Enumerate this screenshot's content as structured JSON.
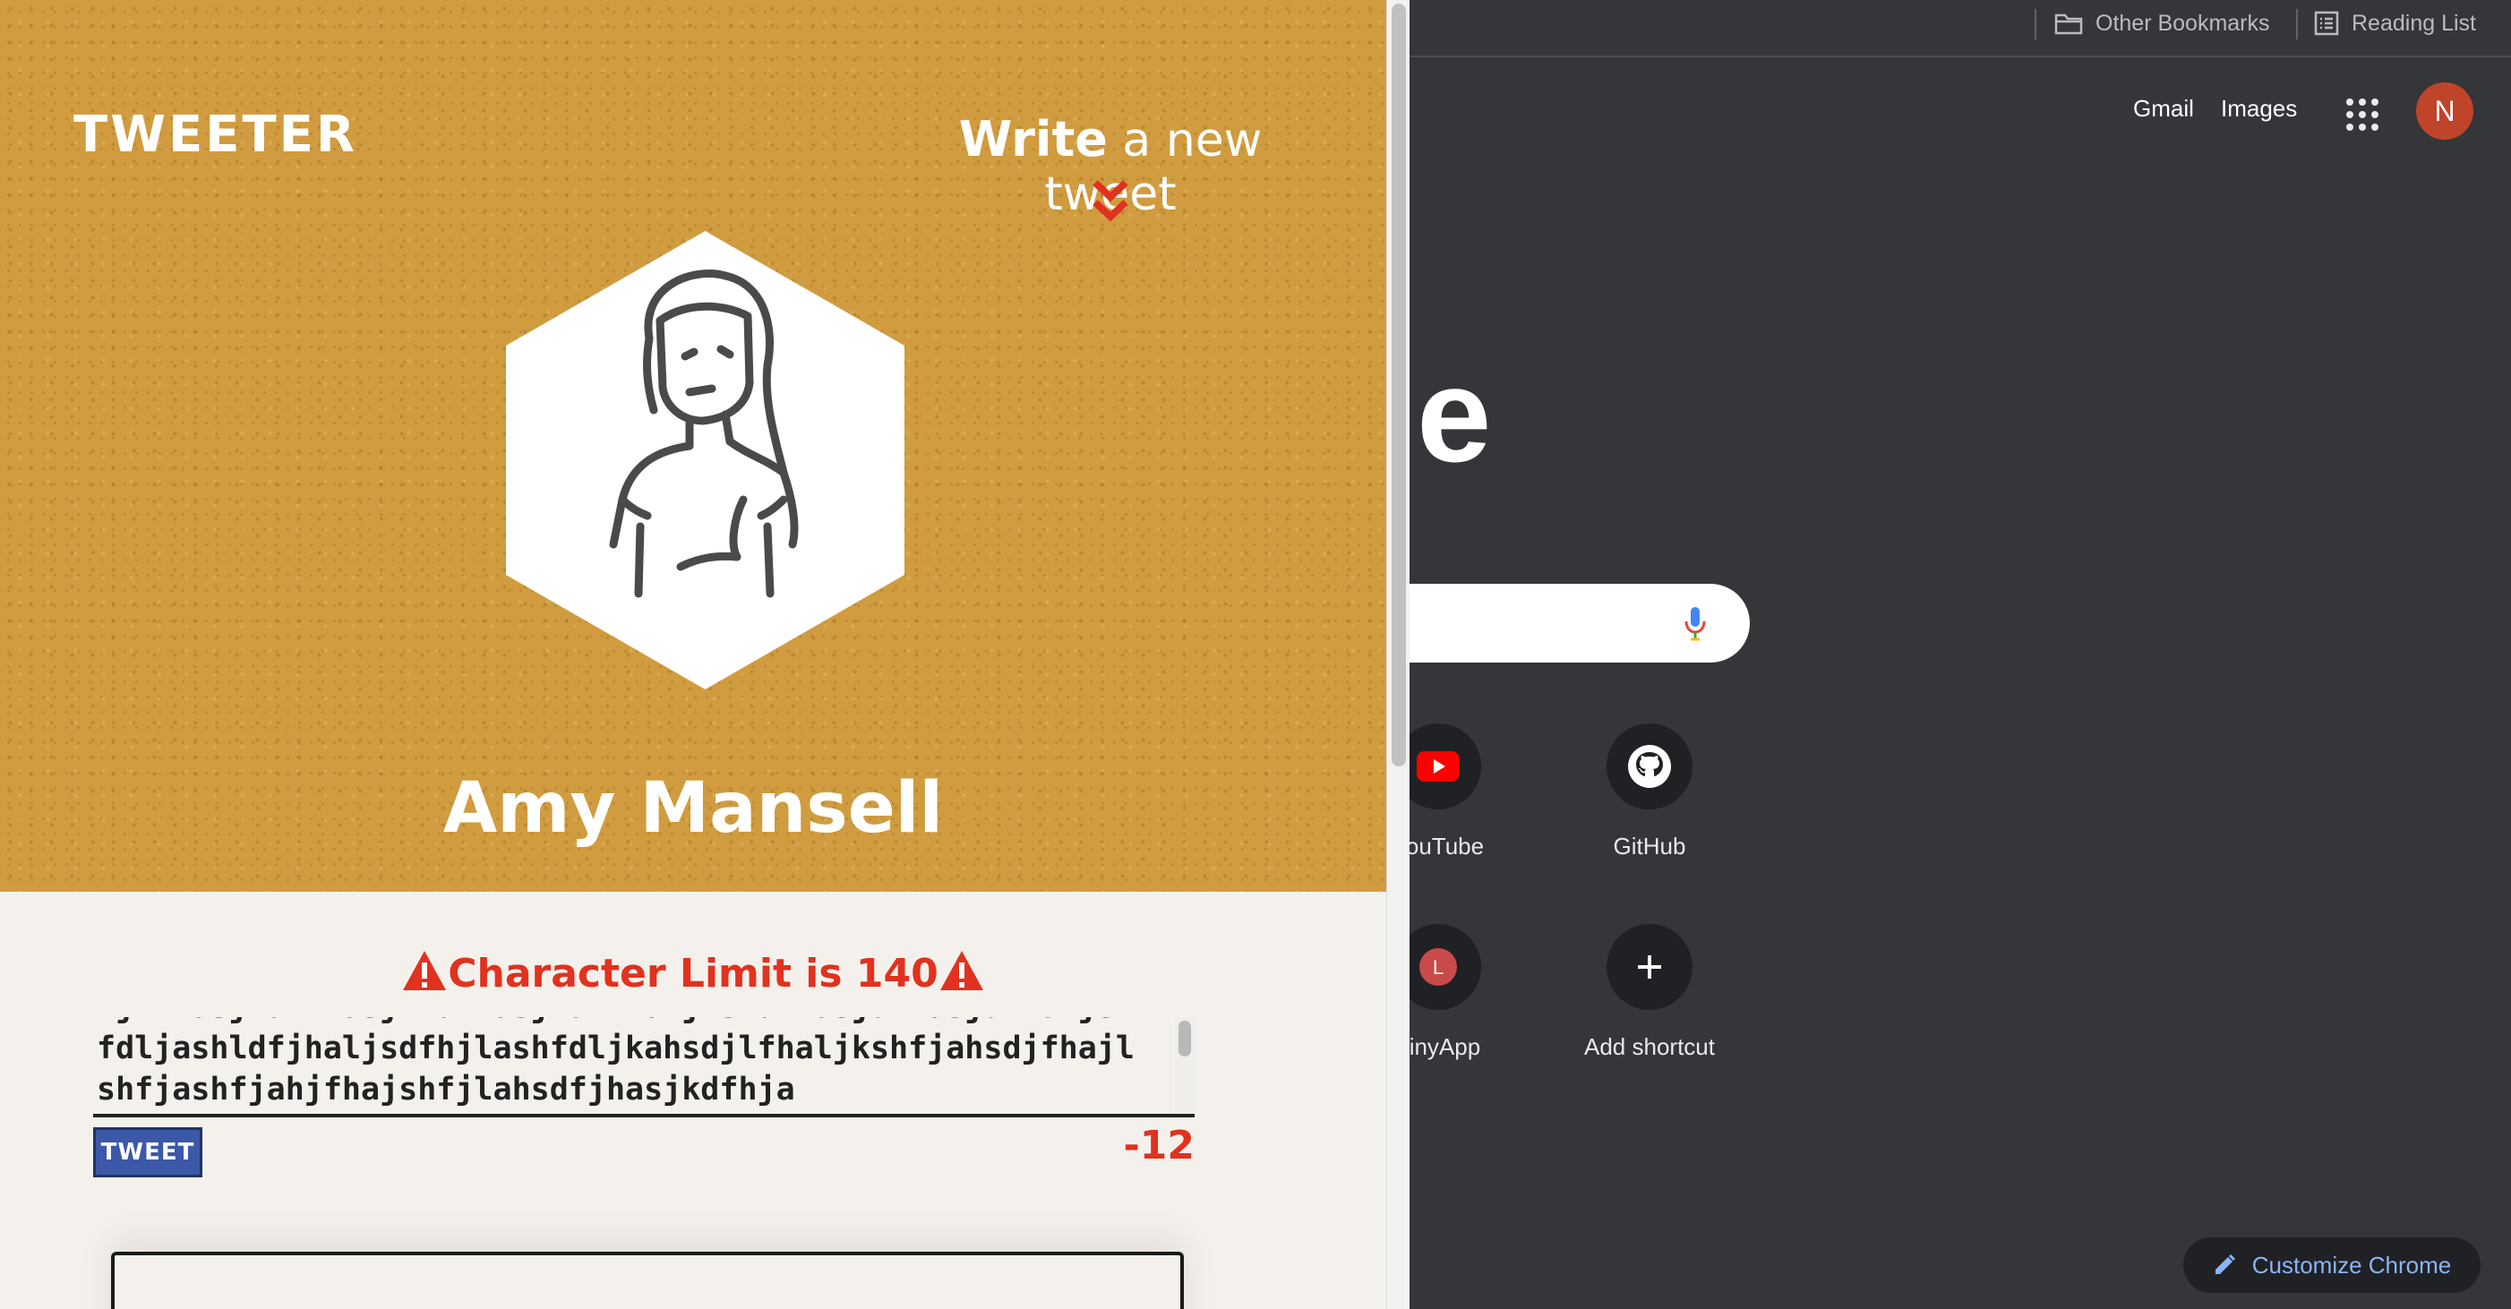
{
  "tweeter": {
    "logo": "TWEETER",
    "compose_toggle": {
      "strong": "Write",
      "light": " a new tweet"
    },
    "user_name": "Amy Mansell",
    "limit_warning": "Character Limit is 140",
    "tweet_text": "ljkfhasjkdlfhasjkldfhasjkdlfhaljkshdfhasjdfhasjdkhaljshfdljashldfjhaljsdfhjlashfdljkahsdjlfhaljkshfjahsdjfhajlshfjashfjahjfhajshfjlahsdfjhasjkdfhja",
    "tweet_button": "TWEET",
    "char_counter": "-12",
    "colors": {
      "header": "#d09c3f",
      "warning": "#e0321f",
      "button": "#3c58a8"
    },
    "icons": [
      "chevron-down-icon",
      "user-avatar-icon",
      "warning-icon"
    ]
  },
  "chrome": {
    "bookmarks": [
      {
        "label": "Other Bookmarks",
        "icon": "folder-icon"
      },
      {
        "label": "Reading List",
        "icon": "reading-list-icon"
      }
    ],
    "top_links": {
      "gmail": "Gmail",
      "images": "Images"
    },
    "account_initial": "N",
    "logo_fragment": "e",
    "shortcuts": [
      {
        "title": "YouTube",
        "icon": "youtube-icon"
      },
      {
        "title": "GitHub",
        "icon": "github-icon"
      },
      {
        "title": "TinyApp",
        "icon": "tinyapp-icon",
        "initial": "L"
      },
      {
        "title": "Add shortcut",
        "icon": "plus-icon"
      }
    ],
    "customize_label": "Customize Chrome",
    "colors": {
      "background": "#35363a",
      "accent": "#8ab4f8",
      "avatar": "#c0442a"
    }
  }
}
